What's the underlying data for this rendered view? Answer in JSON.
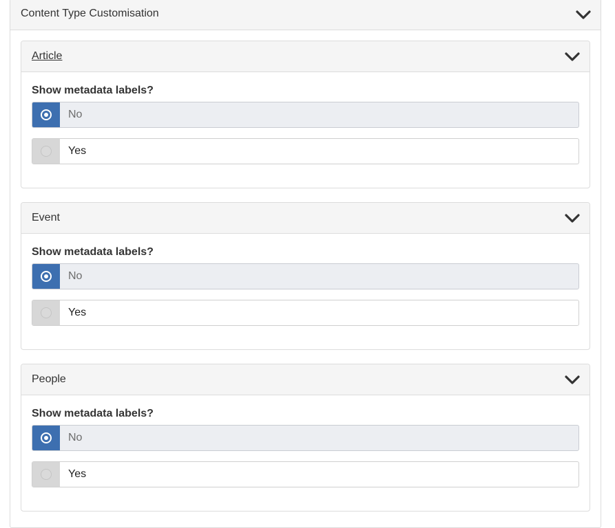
{
  "section": {
    "title": "Content Type Customisation",
    "toggle_icon": "chevron-down-icon"
  },
  "panels": [
    {
      "title": "Article",
      "is_link": true,
      "question": "Show metadata labels?",
      "options": [
        {
          "label": "No",
          "selected": true
        },
        {
          "label": "Yes",
          "selected": false
        }
      ]
    },
    {
      "title": "Event",
      "is_link": false,
      "question": "Show metadata labels?",
      "options": [
        {
          "label": "No",
          "selected": true
        },
        {
          "label": "Yes",
          "selected": false
        }
      ]
    },
    {
      "title": "People",
      "is_link": false,
      "question": "Show metadata labels?",
      "options": [
        {
          "label": "No",
          "selected": true
        },
        {
          "label": "Yes",
          "selected": false
        }
      ]
    }
  ],
  "colors": {
    "selected_accent": "#3d6fb0",
    "header_bg": "#f5f5f5",
    "border": "#dcdcdc"
  }
}
